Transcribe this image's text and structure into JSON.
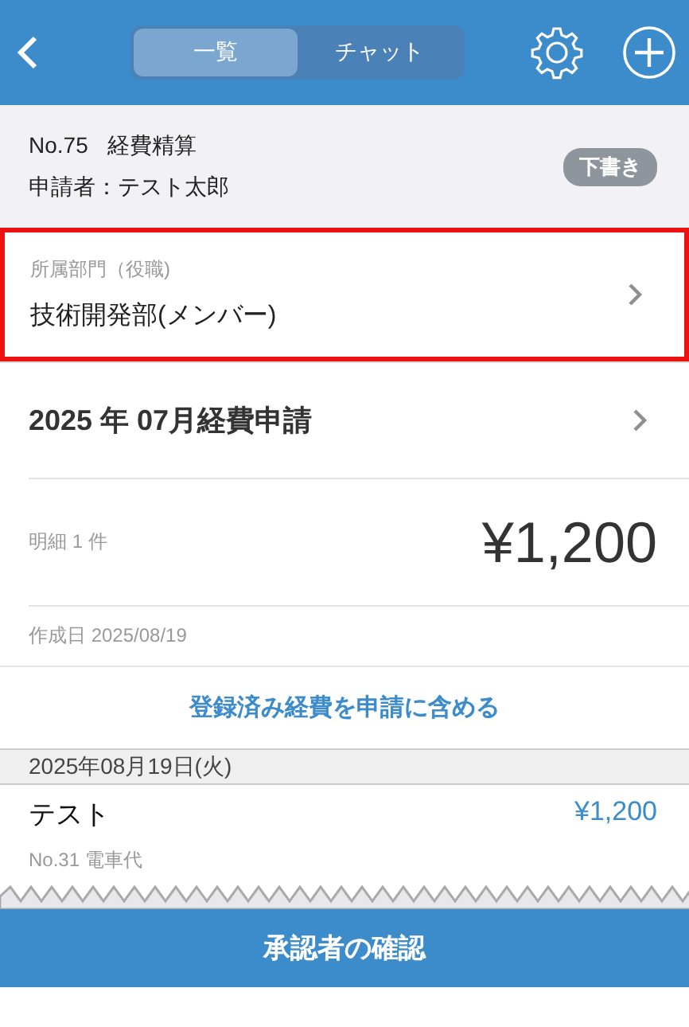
{
  "header": {
    "tabs": [
      {
        "label": "一覧",
        "selected": true
      },
      {
        "label": "チャット",
        "selected": false
      }
    ]
  },
  "summary": {
    "number": "No.75",
    "type": "経費精算",
    "applicant": "申請者：テスト太郎",
    "status": "下書き"
  },
  "department": {
    "label": "所属部門（役職)",
    "value": "技術開発部(メンバー)",
    "highlighted": true
  },
  "report": {
    "title": "2025 年 07月経費申請",
    "count": "明細 1 件",
    "total": "¥1,200",
    "created": "作成日 2025/08/19",
    "link": "登録済み経費を申請に含める"
  },
  "groups": [
    {
      "date": "2025年08月19日(火)",
      "items": [
        {
          "title": "テスト",
          "amount": "¥1,200",
          "detail": "No.31 電車代"
        }
      ]
    }
  ],
  "footer_button": "承認者の確認"
}
